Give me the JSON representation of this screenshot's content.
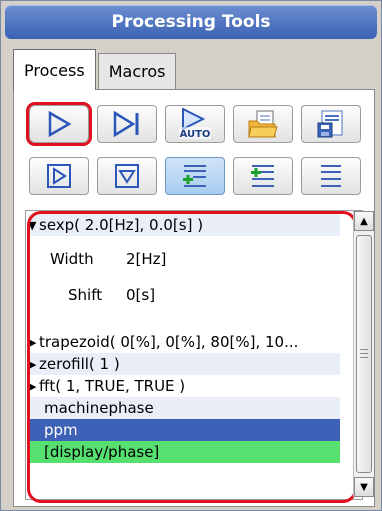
{
  "window": {
    "title": "Processing Tools"
  },
  "tabs": [
    {
      "label": "Process",
      "active": true
    },
    {
      "label": "Macros",
      "active": false
    }
  ],
  "toolbar_row1": [
    {
      "name": "run-icon"
    },
    {
      "name": "step-icon"
    },
    {
      "name": "auto-icon",
      "label": "AUTO"
    },
    {
      "name": "open-folder-icon"
    },
    {
      "name": "save-list-icon"
    }
  ],
  "toolbar_row2": [
    {
      "name": "play-box-icon"
    },
    {
      "name": "down-box-icon"
    },
    {
      "name": "add-list-icon"
    },
    {
      "name": "insert-list-icon"
    },
    {
      "name": "list-icon"
    }
  ],
  "process_list": {
    "items": [
      {
        "label": "sexp( 2.0[Hz], 0.0[s] )",
        "expanded": true
      },
      {
        "label": "trapezoid( 0[%], 0[%], 80[%], 10...",
        "expanded": false
      },
      {
        "label": "zerofill( 1 )",
        "expanded": false
      },
      {
        "label": "fft( 1, TRUE, TRUE )",
        "expanded": false
      },
      {
        "label": "machinephase"
      },
      {
        "label": "ppm",
        "selected": true
      },
      {
        "label": "[display/phase]",
        "highlighted": true
      }
    ],
    "params": [
      {
        "name": "Width",
        "value": "2[Hz]"
      },
      {
        "name": "Shift",
        "value": "0[s]"
      }
    ]
  },
  "colors": {
    "title_bg": "#3b62b3",
    "selected": "#3d61b7",
    "highlight_green": "#55e070",
    "annotation_red": "#e0101e"
  }
}
